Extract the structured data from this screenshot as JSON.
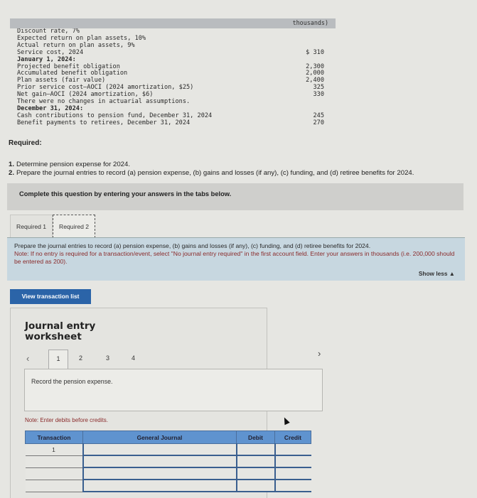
{
  "given": {
    "header_label": "thousands)",
    "rows": [
      {
        "label": "Discount rate, 7%",
        "value": "",
        "bold": false
      },
      {
        "label": "Expected return on plan assets, 10%",
        "value": "",
        "bold": false
      },
      {
        "label": "Actual return on plan assets, 9%",
        "value": "",
        "bold": false
      },
      {
        "label": "Service cost, 2024",
        "value": "$ 310",
        "bold": false
      },
      {
        "label": "January 1, 2024:",
        "value": "",
        "bold": true
      },
      {
        "label": "Projected benefit obligation",
        "value": "2,300",
        "bold": false
      },
      {
        "label": "Accumulated benefit obligation",
        "value": "2,000",
        "bold": false
      },
      {
        "label": "Plan assets (fair value)",
        "value": "2,400",
        "bold": false
      },
      {
        "label": "Prior service cost–AOCI (2024 amortization, $25)",
        "value": "325",
        "bold": false
      },
      {
        "label": "Net gain–AOCI (2024 amortization, $6)",
        "value": "330",
        "bold": false
      },
      {
        "label": "There were no changes in actuarial assumptions.",
        "value": "",
        "bold": false
      },
      {
        "label": "December 31, 2024:",
        "value": "",
        "bold": true
      },
      {
        "label": "Cash contributions to pension fund, December 31, 2024",
        "value": "245",
        "bold": false
      },
      {
        "label": "Benefit payments to retirees, December 31, 2024",
        "value": "270",
        "bold": false
      }
    ]
  },
  "required": {
    "title": "Required:",
    "items": [
      {
        "num": "1.",
        "text": "Determine pension expense for 2024."
      },
      {
        "num": "2.",
        "text": "Prepare the journal entries to record (a) pension expense, (b) gains and losses (if any), (c) funding, and (d) retiree benefits for 2024."
      }
    ]
  },
  "complete_bar": "Complete this question by entering your answers in the tabs below.",
  "tabs": [
    {
      "label": "Required 1",
      "active": false
    },
    {
      "label": "Required 2",
      "active": true
    }
  ],
  "instructions": {
    "line1": "Prepare the journal entries to record (a) pension expense, (b) gains and losses (if any), (c) funding, and (d) retiree benefits for 2024.",
    "note": "Note: If no entry is required for a transaction/event, select \"No journal entry required\" in the first account field. Enter your answers in thousands (i.e. 200,000 should be entered as 200).",
    "show_less": "Show less ▲"
  },
  "view_transaction_button": "View transaction list",
  "worksheet": {
    "title": "Journal entry worksheet",
    "prev_icon": "‹",
    "next_icon": "›",
    "pages": [
      "1",
      "2",
      "3",
      "4"
    ],
    "active_page": "1",
    "description": "Record the pension expense.",
    "note": "Note: Enter debits before credits.",
    "table": {
      "headers": [
        "Transaction",
        "General Journal",
        "Debit",
        "Credit"
      ],
      "rows": [
        {
          "transaction": "1",
          "account": "",
          "debit": "",
          "credit": ""
        },
        {
          "transaction": "",
          "account": "",
          "debit": "",
          "credit": ""
        },
        {
          "transaction": "",
          "account": "",
          "debit": "",
          "credit": ""
        },
        {
          "transaction": "",
          "account": "",
          "debit": "",
          "credit": ""
        }
      ]
    }
  }
}
